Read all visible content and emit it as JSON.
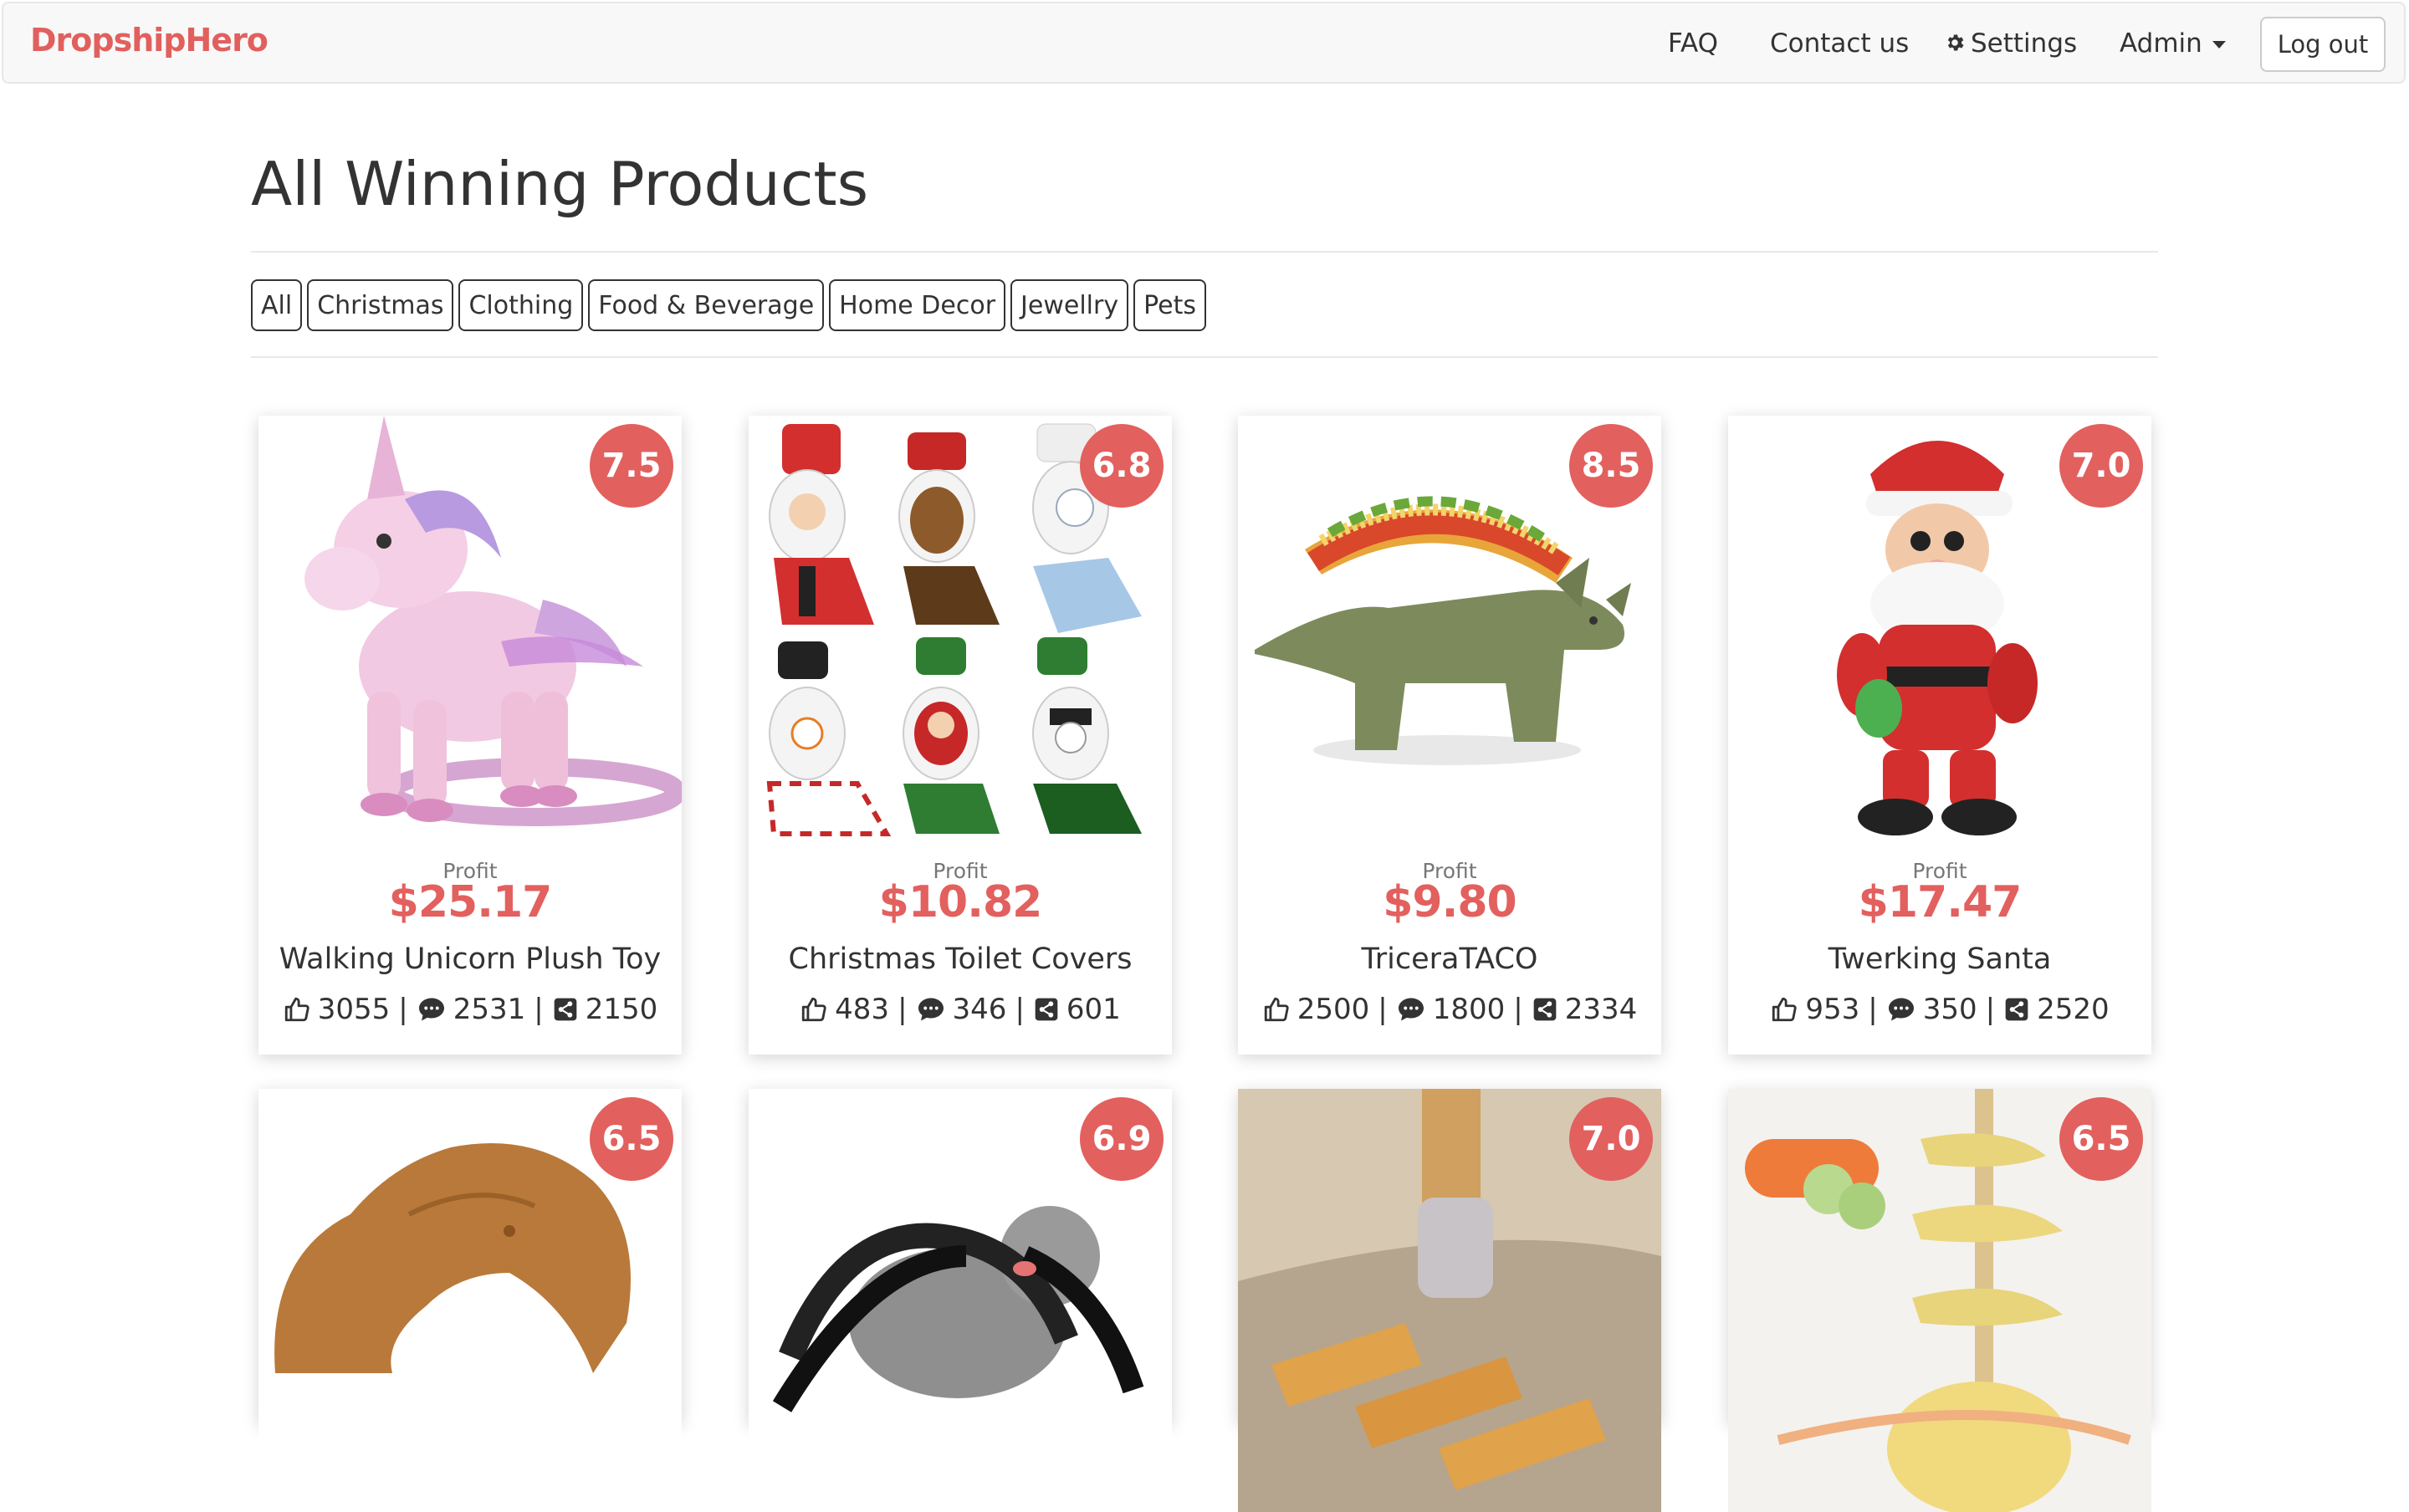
{
  "nav": {
    "brand": "DropshipHero",
    "faq": "FAQ",
    "contact": "Contact us",
    "settings": "Settings",
    "admin": "Admin",
    "logout": "Log out"
  },
  "page": {
    "title": "All Winning Products"
  },
  "filters": [
    "All",
    "Christmas",
    "Clothing",
    "Food & Beverage",
    "Home Decor",
    "Jewellry",
    "Pets"
  ],
  "colors": {
    "accent": "#e2605e",
    "brand": "#e1605e"
  },
  "products": [
    {
      "score": "7.5",
      "profit_label": "Profit",
      "profit": "$25.17",
      "title": "Walking Unicorn Plush Toy",
      "likes": "3055",
      "comments": "2531",
      "shares": "2150",
      "image": "unicorn-plush"
    },
    {
      "score": "6.8",
      "profit_label": "Profit",
      "profit": "$10.82",
      "title": "Christmas Toilet Covers",
      "likes": "483",
      "comments": "346",
      "shares": "601",
      "image": "toilet-covers"
    },
    {
      "score": "8.5",
      "profit_label": "Profit",
      "profit": "$9.80",
      "title": "TriceraTACO",
      "likes": "2500",
      "comments": "1800",
      "shares": "2334",
      "image": "taco-dinosaur"
    },
    {
      "score": "7.0",
      "profit_label": "Profit",
      "profit": "$17.47",
      "title": "Twerking Santa",
      "likes": "953",
      "comments": "350",
      "shares": "2520",
      "image": "santa-toy"
    },
    {
      "score": "6.5",
      "image": "pillow-arm"
    },
    {
      "score": "6.9",
      "image": "spider-dog-costume"
    },
    {
      "score": "7.0",
      "image": "cat-leg-socks"
    },
    {
      "score": "6.5",
      "image": "potato-spiral"
    }
  ]
}
